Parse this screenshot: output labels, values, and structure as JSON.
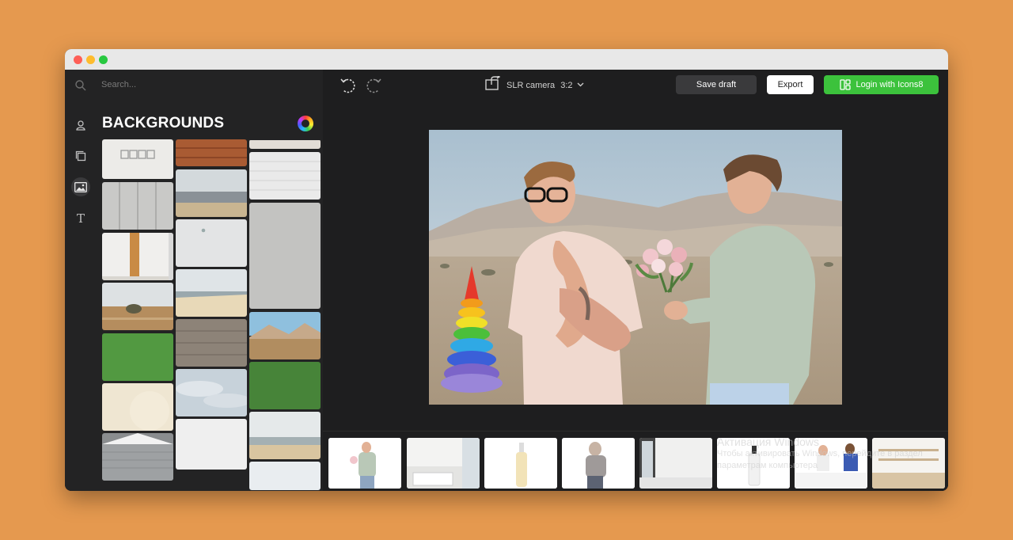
{
  "app": {
    "window_controls": [
      "close",
      "minimize",
      "maximize"
    ]
  },
  "sidebar": {
    "search_placeholder": "Search...",
    "rail_icons": [
      "person-icon",
      "layers-icon",
      "image-icon",
      "text-icon"
    ],
    "rail_text_glyph": "T",
    "panel_title": "BACKGROUNDS",
    "backgrounds": [
      "white wall with frames",
      "white panel wall",
      "white wall with wooden door",
      "desert with bush",
      "green grass",
      "beige plaster",
      "grey garage door",
      "brick wall",
      "beach seascape",
      "white wall with outlet",
      "beach shoreline",
      "wooden planks",
      "cloudy sky",
      "plain white",
      "white brick",
      "white brick wall",
      "grey concrete",
      "desert mountains",
      "green grass top",
      "beach waves",
      "white wall"
    ]
  },
  "toolbar": {
    "undo_icon": "undo-icon",
    "redo_icon": "redo-icon",
    "format_label": "SLR camera",
    "format_ratio": "3:2",
    "save_label": "Save draft",
    "export_label": "Export",
    "login_label": "Login with Icons8"
  },
  "canvas": {
    "scene": "desert background with two men, flowers and toy pyramid"
  },
  "strip": {
    "items": [
      "man with bouquet",
      "white kitchen",
      "cream bottle",
      "woman with coffee",
      "white room with window",
      "soap dispenser",
      "people at table",
      "kitchen interior"
    ],
    "watermark_line1": "Активация Windows",
    "watermark_line2": "Чтобы активировать Windows, перейдите в раздел",
    "watermark_line3": "параметрам компьютера"
  },
  "colors": {
    "background": "#e5994f",
    "app_bg": "#1e1e1f",
    "accent_green": "#3cc23c"
  }
}
